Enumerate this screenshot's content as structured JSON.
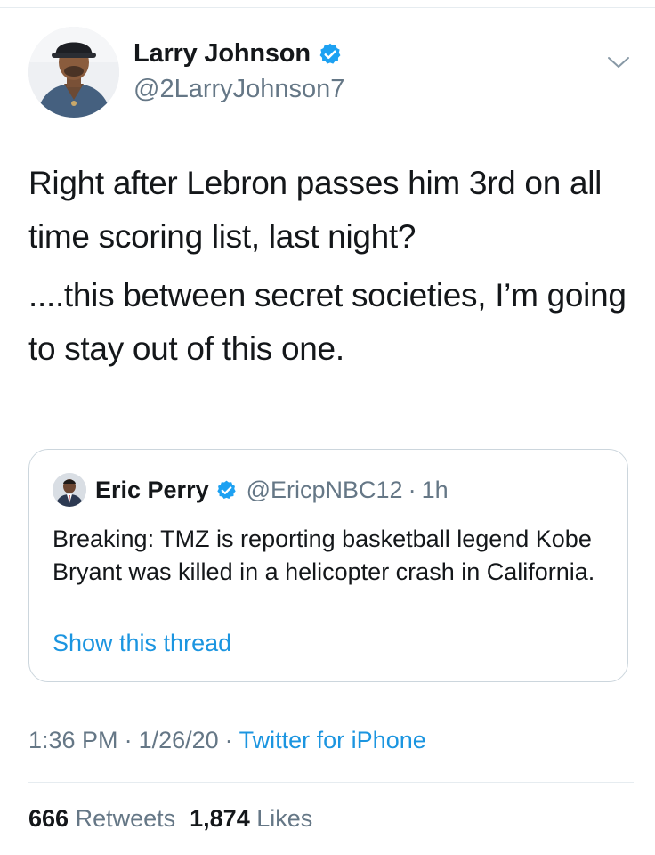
{
  "author": {
    "display_name": "Larry Johnson",
    "handle": "@2LarryJohnson7",
    "verified": true
  },
  "tweet": {
    "paragraphs": [
      "Right after Lebron passes him 3rd on all time scoring list, last night?",
      "....this between secret societies, I’m going to stay out of this one."
    ]
  },
  "quoted": {
    "display_name": "Eric Perry",
    "handle": "@EricpNBC12",
    "separator": "·",
    "time_ago": "1h",
    "text": "Breaking: TMZ is reporting basketball legend Kobe Bryant was killed in a helicopter crash in California.",
    "thread_link": "Show this thread"
  },
  "meta": {
    "time": "1:36 PM",
    "date": "1/26/20",
    "separator": "·",
    "source": "Twitter for iPhone"
  },
  "stats": {
    "retweets_count": "666",
    "retweets_label": "Retweets",
    "likes_count": "1,874",
    "likes_label": "Likes"
  },
  "colors": {
    "link": "#1b95e0",
    "verified_badge": "#1da1f2",
    "secondary_text": "#657786",
    "primary_text": "#14171a"
  },
  "icons": {
    "verified": "verified-badge-icon",
    "menu": "chevron-down-icon"
  }
}
